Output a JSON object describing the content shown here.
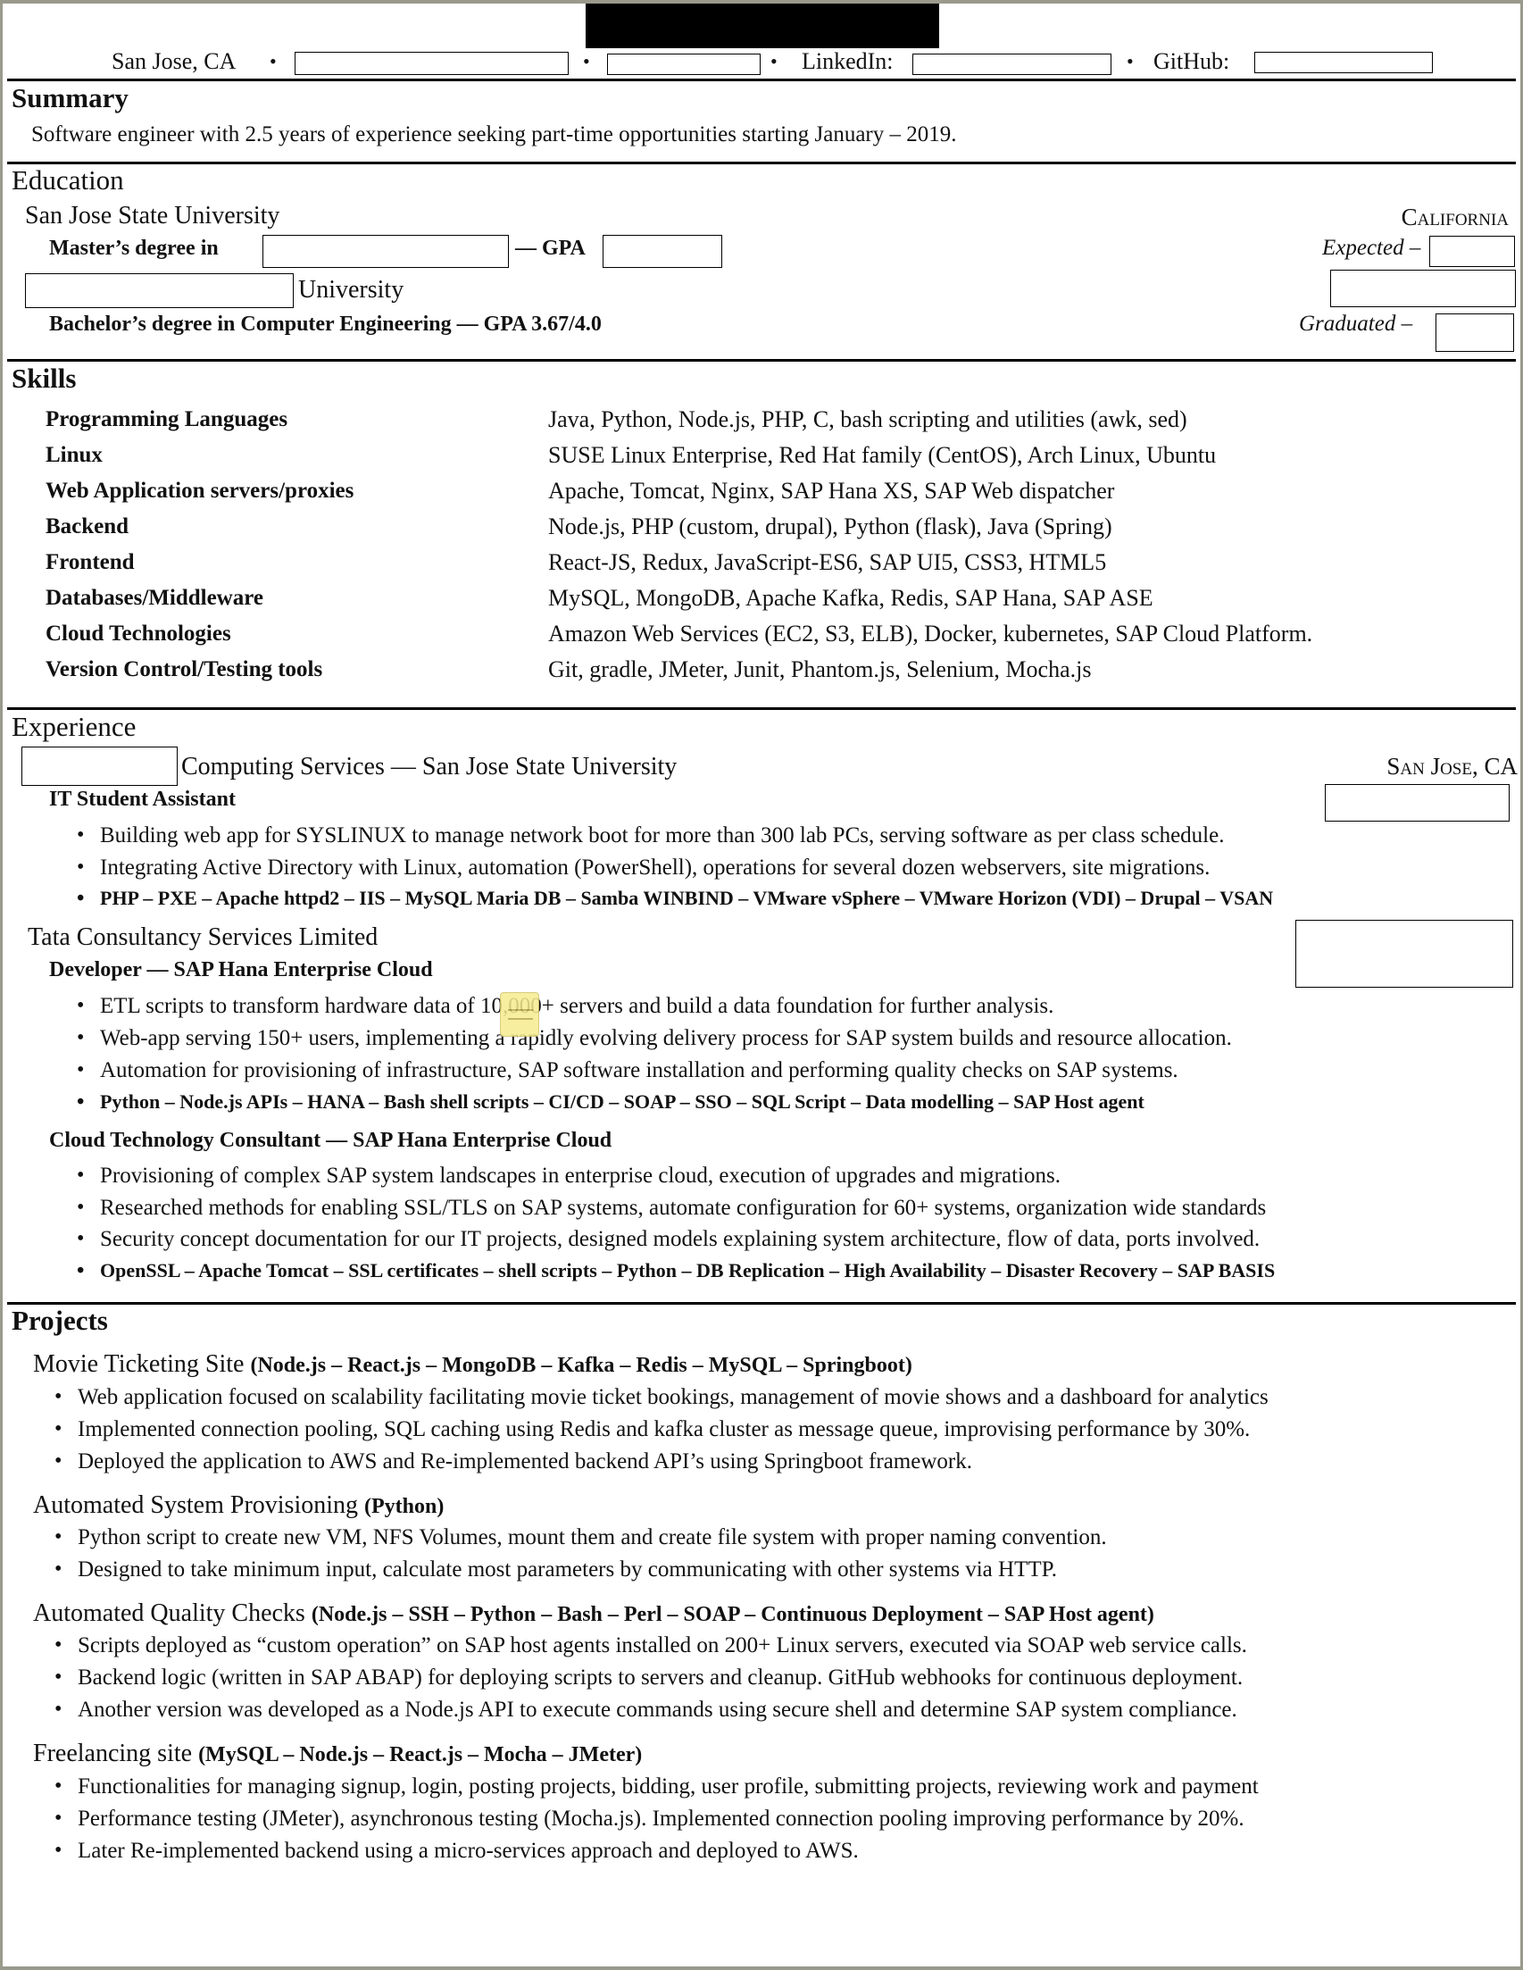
{
  "header": {
    "location": "San Jose, CA",
    "linkedin_label": "LinkedIn:",
    "github_label": "GitHub:"
  },
  "summary": {
    "title": "Summary",
    "text": "Software engineer with 2.5 years of experience seeking part-time opportunities starting January – 2019."
  },
  "education": {
    "title": "Education",
    "school1": "San Jose State University",
    "school1_location": "California",
    "degree1_prefix": "Master’s degree in",
    "degree1_gpa": "— GPA",
    "degree1_date_label": "Expected –",
    "school2_suffix": "University",
    "degree2": "Bachelor’s degree in Computer Engineering — GPA 3.67/4.0",
    "degree2_date_label": "Graduated –"
  },
  "skills": {
    "title": "Skills",
    "rows": [
      {
        "label": "Programming Languages",
        "value": "Java, Python, Node.js, PHP, C, bash scripting and utilities (awk, sed)"
      },
      {
        "label": "Linux",
        "value": "SUSE Linux Enterprise, Red Hat family (CentOS), Arch Linux, Ubuntu"
      },
      {
        "label": "Web Application servers/proxies",
        "value": "Apache, Tomcat, Nginx, SAP Hana XS, SAP Web dispatcher"
      },
      {
        "label": "Backend",
        "value": "Node.js, PHP (custom, drupal), Python (flask), Java (Spring)"
      },
      {
        "label": "Frontend",
        "value": "React-JS, Redux, JavaScript-ES6, SAP UI5, CSS3, HTML5"
      },
      {
        "label": "Databases/Middleware",
        "value": "MySQL, MongoDB, Apache Kafka, Redis, SAP Hana, SAP ASE"
      },
      {
        "label": "Cloud Technologies",
        "value": "Amazon Web Services (EC2, S3, ELB), Docker, kubernetes, SAP Cloud Platform."
      },
      {
        "label": "Version Control/Testing tools",
        "value": "Git, gradle, JMeter, Junit, Phantom.js, Selenium, Mocha.js"
      }
    ]
  },
  "experience": {
    "title": "Experience",
    "jobs": [
      {
        "org": "Computing Services — San Jose State University",
        "location": "San Jose, CA",
        "role": "IT Student Assistant",
        "bullets": [
          "Building web app for SYSLINUX to manage network boot for more than 300 lab PCs, serving software as per class schedule.",
          "Integrating Active Directory with Linux, automation (PowerShell), operations for several dozen webservers, site migrations."
        ],
        "tech": "PHP – PXE – Apache httpd2 – IIS – MySQL Maria DB – Samba WINBIND – VMware vSphere –  VMware Horizon (VDI) – Drupal – VSAN"
      },
      {
        "org": "Tata Consultancy Services Limited",
        "role": "Developer — SAP Hana Enterprise Cloud",
        "bullets": [
          "ETL scripts to transform hardware data of 10,000+ servers and build a data foundation for further analysis.",
          "Web-app serving 150+ users, implementing a rapidly evolving delivery process for SAP system builds and resource allocation.",
          "Automation for provisioning of infrastructure, SAP software installation and performing quality checks on SAP systems."
        ],
        "tech": "Python – Node.js APIs – HANA – Bash shell scripts – CI/CD – SOAP – SSO – SQL Script – Data modelling – SAP Host agent"
      },
      {
        "role": "Cloud Technology Consultant — SAP Hana Enterprise Cloud",
        "bullets": [
          "Provisioning of complex SAP system landscapes in enterprise cloud, execution of upgrades and migrations.",
          "Researched methods for enabling SSL/TLS on SAP systems, automate configuration for 60+ systems, organization wide standards",
          "Security concept documentation for our IT projects, designed models explaining system architecture, flow of data, ports involved."
        ],
        "tech": "OpenSSL – Apache Tomcat – SSL certificates – shell scripts – Python – DB Replication – High Availability – Disaster Recovery – SAP BASIS"
      }
    ]
  },
  "projects": {
    "title": "Projects",
    "items": [
      {
        "name": "Movie Ticketing Site",
        "tech": "(Node.js – React.js – MongoDB – Kafka – Redis – MySQL – Springboot)",
        "bullets": [
          "Web application focused on scalability facilitating movie ticket bookings, management of movie shows and a dashboard for analytics",
          "Implemented connection pooling, SQL caching using Redis and kafka cluster as message queue, improvising performance by 30%.",
          "Deployed the application to AWS and Re-implemented backend API’s using Springboot framework."
        ]
      },
      {
        "name": "Automated System Provisioning",
        "tech": "(Python)",
        "bullets": [
          "Python script to create new VM, NFS Volumes, mount them and create file system with proper naming convention.",
          "Designed to take minimum input, calculate most parameters by communicating with other systems via HTTP."
        ]
      },
      {
        "name": "Automated Quality Checks",
        "tech": "(Node.js – SSH – Python – Bash – Perl – SOAP – Continuous Deployment – SAP Host agent)",
        "bullets": [
          "Scripts deployed as “custom operation” on SAP host agents installed on 200+ Linux servers, executed via SOAP web service calls.",
          "Backend logic (written in SAP ABAP) for deploying scripts to servers and cleanup. GitHub webhooks for continuous deployment.",
          "Another version was developed as a Node.js API to execute commands using secure shell and determine SAP system compliance."
        ]
      },
      {
        "name": "Freelancing site",
        "tech": "(MySQL – Node.js – React.js – Mocha – JMeter)",
        "bullets": [
          "Functionalities for managing signup, login, posting projects, bidding, user profile, submitting projects, reviewing work and payment",
          "Performance testing (JMeter), asynchronous testing (Mocha.js). Implemented connection pooling improving performance by 20%.",
          "Later Re-implemented backend using a micro-services approach and deployed to AWS."
        ]
      }
    ]
  }
}
